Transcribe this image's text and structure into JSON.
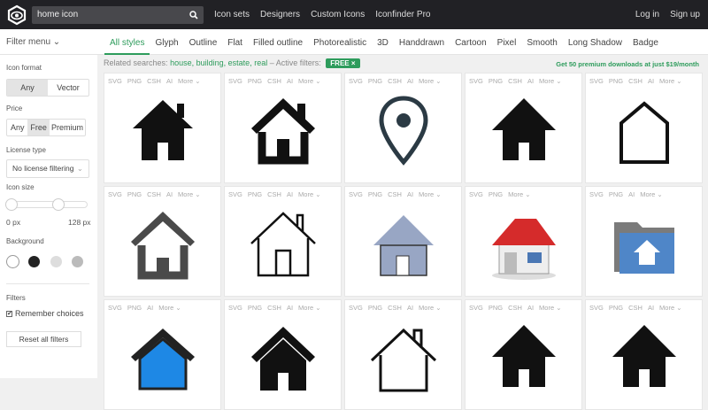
{
  "header": {
    "search_value": "home icon",
    "nav": [
      "Icon sets",
      "Designers",
      "Custom Icons",
      "Iconfinder Pro"
    ],
    "login": "Log in",
    "signup": "Sign up"
  },
  "filter_menu": "Filter menu",
  "tabs": [
    "All styles",
    "Glyph",
    "Outline",
    "Flat",
    "Filled outline",
    "Photorealistic",
    "3D",
    "Handdrawn",
    "Cartoon",
    "Pixel",
    "Smooth",
    "Long Shadow",
    "Badge"
  ],
  "sidebar": {
    "icon_format_label": "Icon format",
    "icon_format": [
      "Any",
      "Vector"
    ],
    "price_label": "Price",
    "price": [
      "Any",
      "Free",
      "Premium"
    ],
    "license_label": "License type",
    "license_value": "No license filtering",
    "size_label": "Icon size",
    "size_min": "0 px",
    "size_max": "128 px",
    "background_label": "Background",
    "filters_label": "Filters",
    "remember": "Remember choices",
    "reset": "Reset all filters"
  },
  "related": {
    "prefix": "Related searches:",
    "terms": [
      "house,",
      "building,",
      "estate,",
      "real"
    ],
    "active": "– Active filters:",
    "badge": "FREE ×"
  },
  "promo": "Get 50 premium downloads at just $19/month",
  "cards": [
    {
      "formats": [
        "SVG",
        "PNG",
        "CSH",
        "AI",
        "More ⌄"
      ],
      "icon": "glyph-house"
    },
    {
      "formats": [
        "SVG",
        "PNG",
        "CSH",
        "AI",
        "More ⌄"
      ],
      "icon": "outline-filled-house"
    },
    {
      "formats": [
        "SVG",
        "PNG",
        "CSH",
        "AI",
        "More ⌄"
      ],
      "icon": "map-pin"
    },
    {
      "formats": [
        "SVG",
        "PNG",
        "CSH",
        "AI",
        "More ⌄"
      ],
      "icon": "solid-house"
    },
    {
      "formats": [
        "SVG",
        "PNG",
        "CSH",
        "AI",
        "More ⌄"
      ],
      "icon": "outline-pentagon-house"
    },
    {
      "formats": [
        "SVG",
        "PNG",
        "CSH",
        "AI",
        "More ⌄"
      ],
      "icon": "gray-house"
    },
    {
      "formats": [
        "SVG",
        "PNG",
        "CSH",
        "AI",
        "More ⌄"
      ],
      "icon": "line-house"
    },
    {
      "formats": [
        "SVG",
        "PNG",
        "CSH",
        "AI",
        "More ⌄"
      ],
      "icon": "blue-gray-house"
    },
    {
      "formats": [
        "SVG",
        "PNG",
        "More ⌄"
      ],
      "icon": "red-roof-house"
    },
    {
      "formats": [
        "SVG",
        "PNG",
        "AI",
        "More ⌄"
      ],
      "icon": "folder-home"
    },
    {
      "formats": [
        "SVG",
        "PNG",
        "AI",
        "More ⌄"
      ],
      "icon": "blue-house"
    },
    {
      "formats": [
        "SVG",
        "PNG",
        "CSH",
        "AI",
        "More ⌄"
      ],
      "icon": "glyph-house-chimney"
    },
    {
      "formats": [
        "SVG",
        "PNG",
        "CSH",
        "AI",
        "More ⌄"
      ],
      "icon": "line-house-chimney"
    },
    {
      "formats": [
        "SVG",
        "PNG",
        "CSH",
        "AI",
        "More ⌄"
      ],
      "icon": "solid-house"
    },
    {
      "formats": [
        "SVG",
        "PNG",
        "CSH",
        "AI",
        "More ⌄"
      ],
      "icon": "solid-house"
    }
  ]
}
